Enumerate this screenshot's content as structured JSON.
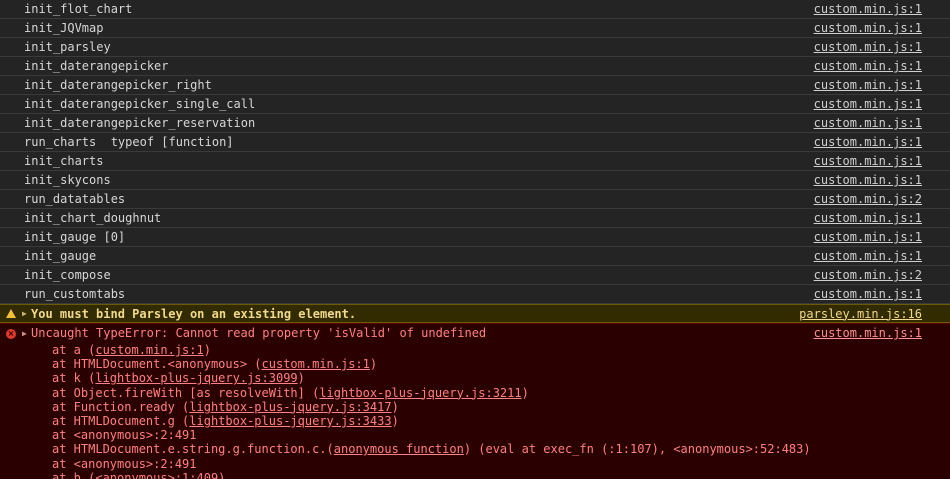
{
  "logs": [
    {
      "message": "init_flot_chart",
      "source": "custom.min.js:1"
    },
    {
      "message": "init_JQVmap",
      "source": "custom.min.js:1"
    },
    {
      "message": "init_parsley",
      "source": "custom.min.js:1"
    },
    {
      "message": "init_daterangepicker",
      "source": "custom.min.js:1"
    },
    {
      "message": "init_daterangepicker_right",
      "source": "custom.min.js:1"
    },
    {
      "message": "init_daterangepicker_single_call",
      "source": "custom.min.js:1"
    },
    {
      "message": "init_daterangepicker_reservation",
      "source": "custom.min.js:1"
    },
    {
      "message": "run_charts  typeof [function]",
      "source": "custom.min.js:1"
    },
    {
      "message": "init_charts",
      "source": "custom.min.js:1"
    },
    {
      "message": "init_skycons",
      "source": "custom.min.js:1"
    },
    {
      "message": "run_datatables",
      "source": "custom.min.js:2"
    },
    {
      "message": "init_chart_doughnut",
      "source": "custom.min.js:1"
    },
    {
      "message": "init_gauge [0]",
      "source": "custom.min.js:1"
    },
    {
      "message": "init_gauge",
      "source": "custom.min.js:1"
    },
    {
      "message": "init_compose",
      "source": "custom.min.js:2"
    },
    {
      "message": "run_customtabs",
      "source": "custom.min.js:1"
    }
  ],
  "warning": {
    "message": "You must bind Parsley on an existing element.",
    "source": "parsley.min.js:16",
    "icon": "warning-triangle-icon",
    "color": "#f2c037"
  },
  "error": {
    "message": "Uncaught TypeError: Cannot read property 'isValid' of undefined",
    "source": "custom.min.js:1",
    "icon": "error-circle-icon",
    "color": "#e0392d",
    "stack": [
      {
        "pre": "at a (",
        "link": "custom.min.js:1",
        "post": ")"
      },
      {
        "pre": "at HTMLDocument.<anonymous> (",
        "link": "custom.min.js:1",
        "post": ")"
      },
      {
        "pre": "at k (",
        "link": "lightbox-plus-jquery.js:3099",
        "post": ")"
      },
      {
        "pre": "at Object.fireWith [as resolveWith] (",
        "link": "lightbox-plus-jquery.js:3211",
        "post": ")"
      },
      {
        "pre": "at Function.ready (",
        "link": "lightbox-plus-jquery.js:3417",
        "post": ")"
      },
      {
        "pre": "at HTMLDocument.g (",
        "link": "lightbox-plus-jquery.js:3433",
        "post": ")"
      },
      {
        "pre": "at <anonymous>:2:491",
        "link": "",
        "post": ""
      },
      {
        "pre": "at HTMLDocument.e.string.g.function.c.(",
        "link": "anonymous function",
        "post": ") (eval at exec_fn (:1:107), <anonymous>:52:483)"
      },
      {
        "pre": "at <anonymous>:2:491",
        "link": "",
        "post": ""
      },
      {
        "pre": "at b (<anonymous>:1:409)",
        "link": "",
        "post": ""
      }
    ]
  }
}
